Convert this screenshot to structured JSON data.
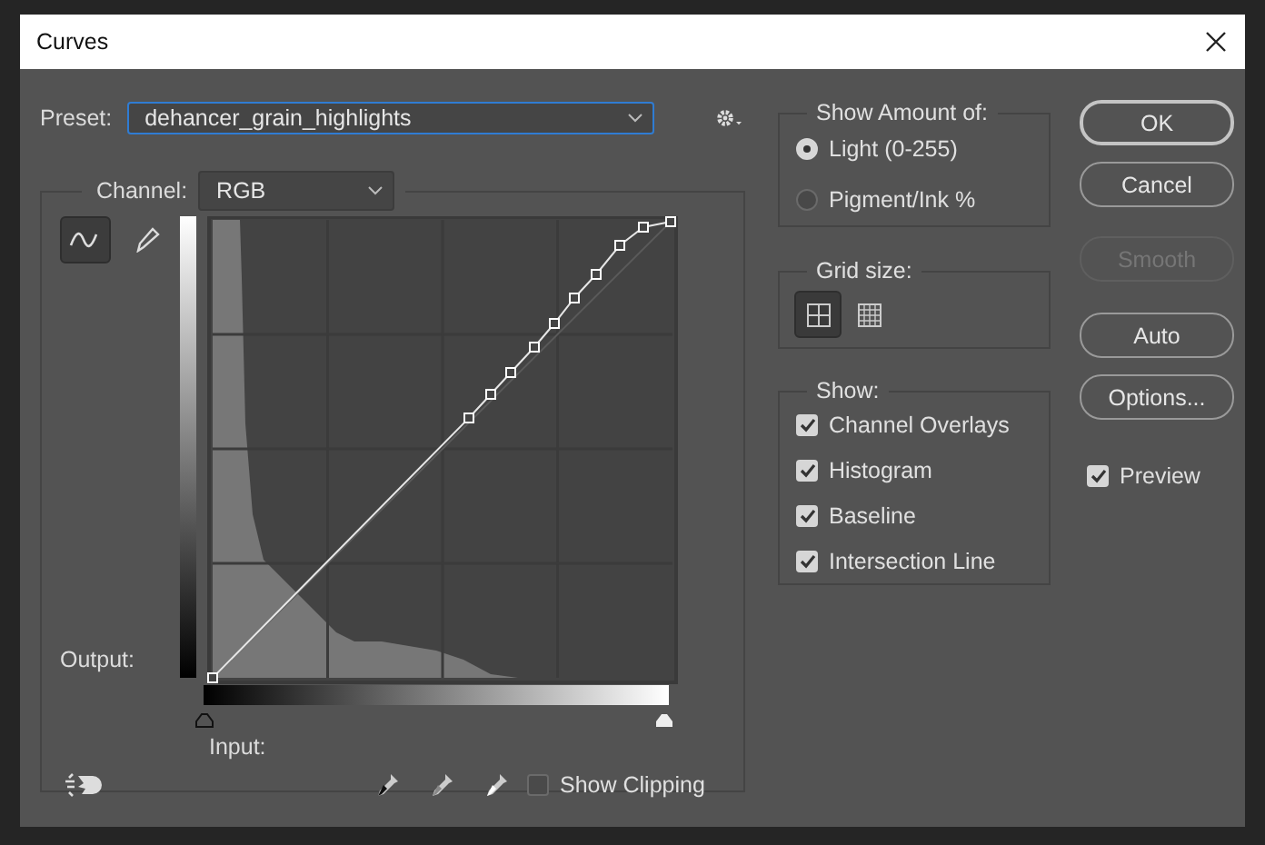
{
  "window": {
    "title": "Curves"
  },
  "preset": {
    "label": "Preset:",
    "value": "dehancer_grain_highlights"
  },
  "channel": {
    "label": "Channel:",
    "value": "RGB"
  },
  "tools": [
    {
      "kind": "curve",
      "selected": true
    },
    {
      "kind": "pencil",
      "selected": false
    }
  ],
  "graph": {
    "output_label": "Output:",
    "input_label": "Input:",
    "input_sliders": [
      {
        "kind": "shadow",
        "level": 0
      },
      {
        "kind": "highlight",
        "level": 1
      }
    ]
  },
  "show_clipping": {
    "label": "Show Clipping",
    "checked": false
  },
  "show_amount": {
    "title": "Show Amount of:",
    "options": [
      {
        "label": "Light  (0-255)",
        "selected": true
      },
      {
        "label": "Pigment/Ink %",
        "selected": false
      }
    ]
  },
  "grid_size": {
    "title": "Grid size:",
    "options": [
      {
        "kind": "simple",
        "selected": true
      },
      {
        "kind": "detailed",
        "selected": false
      }
    ]
  },
  "show": {
    "title": "Show:",
    "options": [
      {
        "label": "Channel Overlays",
        "checked": true
      },
      {
        "label": "Histogram",
        "checked": true
      },
      {
        "label": "Baseline",
        "checked": true
      },
      {
        "label": "Intersection Line",
        "checked": true
      }
    ]
  },
  "buttons": [
    {
      "label": "OK",
      "disabled": false,
      "default": true
    },
    {
      "label": "Cancel",
      "disabled": false,
      "default": false
    },
    {
      "label": "Smooth",
      "disabled": true,
      "default": false
    },
    {
      "label": "Auto",
      "disabled": false,
      "default": false
    },
    {
      "label": "Options...",
      "disabled": false,
      "default": false
    }
  ],
  "preview": {
    "label": "Preview",
    "checked": true
  }
}
